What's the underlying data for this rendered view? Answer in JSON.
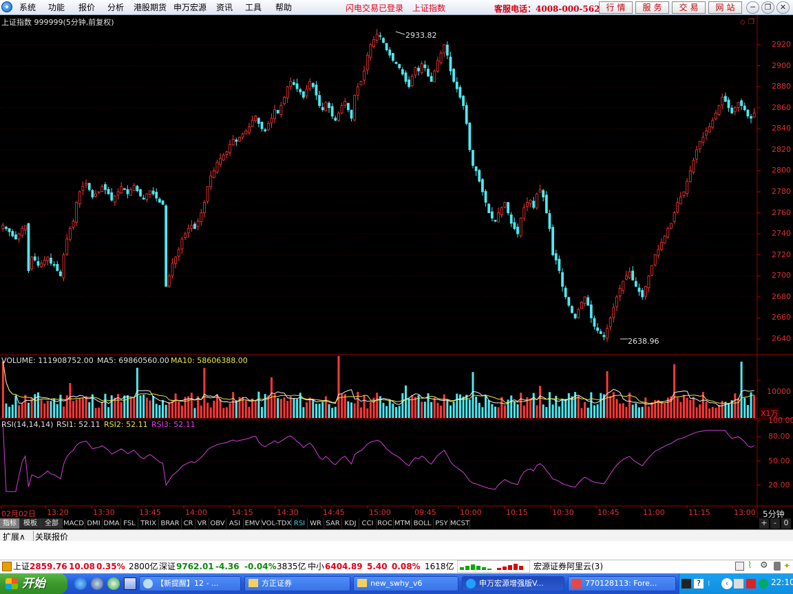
{
  "menubar": {
    "items": [
      "系统",
      "功能",
      "报价",
      "分析",
      "港股期货",
      "申万宏源",
      "资讯",
      "工具",
      "帮助"
    ],
    "status_login": "闪电交易已登录",
    "status_index": "上证指数",
    "hotline": "客服电话：4008-000-562",
    "buttons": [
      "行情",
      "服务",
      "交易",
      "网站"
    ]
  },
  "chart": {
    "title": "上证指数 999999(5分钟,前复权)",
    "high_label": "2933.82",
    "low_label": "2638.96",
    "y_ticks": [
      "2920",
      "2900",
      "2880",
      "2860",
      "2840",
      "2820",
      "2800",
      "2780",
      "2760",
      "2740",
      "2720",
      "2700",
      "2680",
      "2660",
      "2640"
    ],
    "x_ticks": [
      "02月02日",
      "13:20",
      "13:30",
      "13:45",
      "14:00",
      "14:15",
      "14:30",
      "14:45",
      "15:00",
      "09:45",
      "10:00",
      "10:15",
      "10:30",
      "10:45",
      "11:00",
      "11:15",
      "13:00"
    ],
    "x_period": "5分钟",
    "volume_header": {
      "label": "VOLUME: 111908752.00",
      "ma5": "MA5: 69860560.00",
      "ma10": "MA10: 58606388.00"
    },
    "volume_tick": "10000",
    "volume_unit": "X1万",
    "rsi_header": {
      "label": "RSI(14,14,14)",
      "rsi1": "RSI1: 52.11",
      "rsi2": "RSI2: 52.11",
      "rsi3": "RSI3: 52.11"
    },
    "rsi_ticks": [
      "100.00",
      "80.00",
      "50.00",
      "20.00"
    ]
  },
  "tabs": [
    "指标",
    "模板",
    "全部",
    "MACD",
    "DMI",
    "DMA",
    "FSL",
    "TRIX",
    "BRAR",
    "CR",
    "VR",
    "OBV",
    "ASI",
    "EMV",
    "VOL-TDX",
    "RSI",
    "WR",
    "SAR",
    "KDJ",
    "CCI",
    "ROC",
    "MTM",
    "BOLL",
    "PSY",
    "MCST"
  ],
  "tab_controls": [
    "+",
    "-",
    "0"
  ],
  "subbar": {
    "expand": "扩展∧",
    "related": "关联报价"
  },
  "quotes": {
    "sh_name": "上证",
    "sh_value": "2859.76",
    "sh_change": "10.08",
    "sh_pct": "0.35%",
    "sh_amount": "2800亿",
    "sz_name": "深证",
    "sz_value": "9762.01",
    "sz_change": "-4.36",
    "sz_pct": "-0.04%",
    "sz_amount": "3835亿",
    "zx_name": "中小",
    "zx_value": "6404.89",
    "zx_change": "5.40",
    "zx_pct": "0.08%",
    "zx_amount": "1618亿",
    "server": "宏源证券阿里云(3)"
  },
  "taskbar": {
    "start": "开始",
    "tasks": [
      "【新提醒】12 - ...",
      "方正证券",
      "new_swhy_v6",
      "申万宏源增强版V...",
      "770128113: Fore..."
    ],
    "clock": "22:10"
  },
  "chart_data": {
    "type": "candlestick",
    "title": "上证指数 999999(5分钟,前复权)",
    "ylim": [
      2630,
      2940
    ],
    "price_close": [
      2748,
      2745,
      2742,
      2738,
      2735,
      2740,
      2745,
      2748,
      2705,
      2718,
      2715,
      2710,
      2712,
      2715,
      2718,
      2712,
      2710,
      2705,
      2700,
      2720,
      2735,
      2745,
      2752,
      2770,
      2780,
      2785,
      2788,
      2782,
      2775,
      2778,
      2780,
      2785,
      2782,
      2778,
      2772,
      2776,
      2780,
      2785,
      2782,
      2778,
      2782,
      2786,
      2781,
      2776,
      2773,
      2778,
      2781,
      2778,
      2774,
      2770,
      2768,
      2690,
      2700,
      2712,
      2718,
      2725,
      2735,
      2740,
      2745,
      2748,
      2745,
      2752,
      2760,
      2770,
      2785,
      2795,
      2800,
      2808,
      2812,
      2815,
      2818,
      2825,
      2830,
      2828,
      2832,
      2835,
      2838,
      2842,
      2848,
      2852,
      2845,
      2840,
      2838,
      2845,
      2850,
      2858,
      2855,
      2862,
      2870,
      2880,
      2885,
      2882,
      2878,
      2875,
      2870,
      2878,
      2885,
      2880,
      2872,
      2862,
      2858,
      2865,
      2860,
      2852,
      2848,
      2855,
      2862,
      2866,
      2858,
      2850,
      2872,
      2880,
      2885,
      2895,
      2910,
      2920,
      2925,
      2930,
      2928,
      2922,
      2915,
      2910,
      2905,
      2902,
      2898,
      2892,
      2885,
      2880,
      2890,
      2898,
      2895,
      2902,
      2898,
      2890,
      2885,
      2895,
      2905,
      2912,
      2920,
      2910,
      2895,
      2885,
      2878,
      2870,
      2862,
      2845,
      2820,
      2805,
      2800,
      2790,
      2780,
      2770,
      2760,
      2755,
      2752,
      2760,
      2765,
      2770,
      2760,
      2750,
      2745,
      2740,
      2755,
      2765,
      2770,
      2772,
      2765,
      2778,
      2782,
      2775,
      2760,
      2745,
      2720,
      2715,
      2705,
      2690,
      2680,
      2672,
      2665,
      2660,
      2668,
      2675,
      2680,
      2672,
      2660,
      2652,
      2648,
      2645,
      2642,
      2650,
      2660,
      2670,
      2680,
      2688,
      2695,
      2700,
      2704,
      2696,
      2690,
      2685,
      2680,
      2690,
      2700,
      2710,
      2720,
      2725,
      2732,
      2738,
      2745,
      2750,
      2760,
      2770,
      2775,
      2780,
      2790,
      2800,
      2810,
      2820,
      2828,
      2832,
      2838,
      2842,
      2848,
      2855,
      2862,
      2870,
      2866,
      2860,
      2855,
      2860,
      2865,
      2862,
      2858,
      2852,
      2850,
      2855
    ],
    "volume_ylim": [
      0,
      16000
    ],
    "rsi_ylim": [
      0,
      100
    ],
    "rsi_ticks": [
      20,
      50,
      80,
      100
    ]
  }
}
